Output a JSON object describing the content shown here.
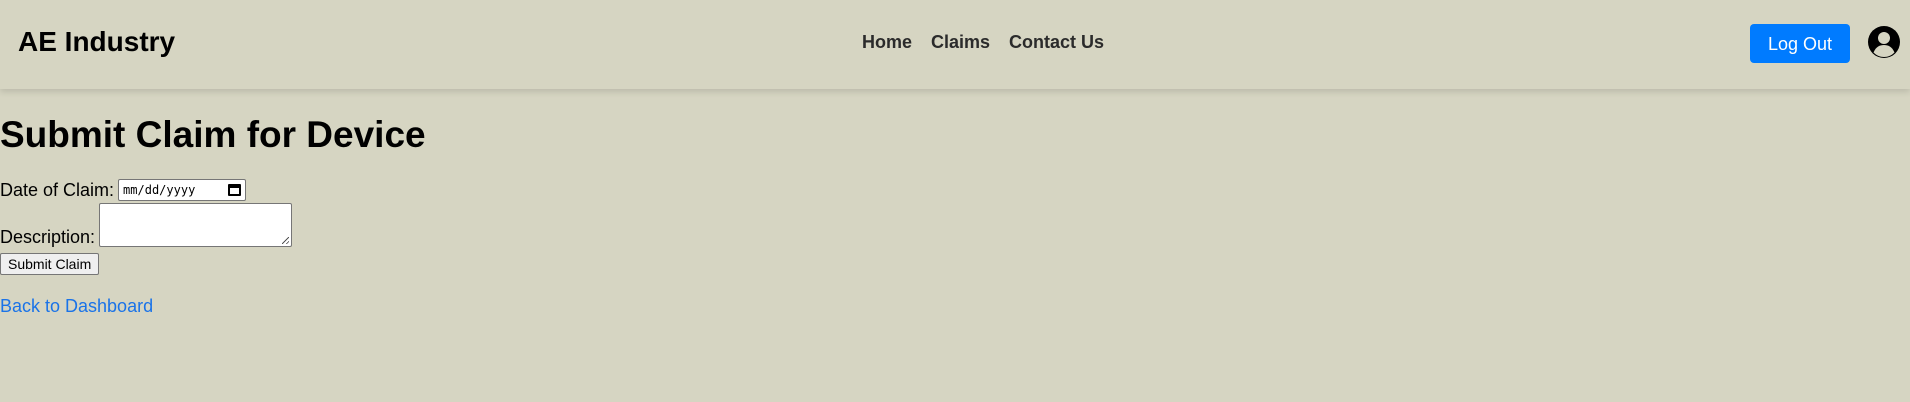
{
  "navbar": {
    "brand": "AE Industry",
    "links": [
      "Home",
      "Claims",
      "Contact Us"
    ],
    "logout_label": "Log Out",
    "avatar_icon": "user-circle-icon",
    "accent_color": "#007bff"
  },
  "page": {
    "title": "Submit Claim for Device",
    "date_label": "Date of Claim:",
    "date_placeholder": "mm/dd/yyyy",
    "description_label": "Description:",
    "description_value": "",
    "submit_label": "Submit Claim",
    "back_link": "Back to Dashboard"
  },
  "theme": {
    "background": "#d6d5c2",
    "link_color": "#1a73e8"
  }
}
